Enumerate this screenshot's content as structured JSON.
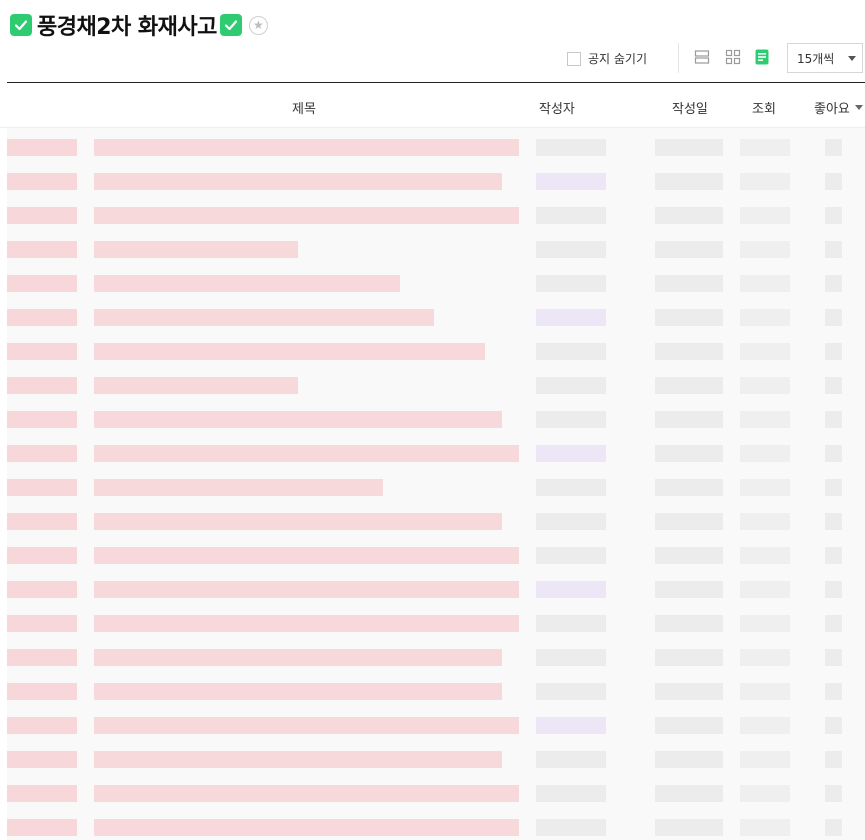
{
  "header": {
    "title": "풍경채2차 화재사고",
    "left_icon": "check-badge-icon",
    "right_icon": "check-badge-icon",
    "favorite_icon": "star-icon"
  },
  "toolbar": {
    "hide_notice_label": "공지 숨기기",
    "hide_notice_checked": false,
    "view_modes": [
      "list-card-icon",
      "album-grid-icon",
      "list-text-icon"
    ],
    "active_view": "list-text-icon",
    "page_size": "15개씩"
  },
  "table": {
    "columns": {
      "title": "제목",
      "author": "작성자",
      "date": "작성일",
      "views": "조회",
      "likes": "좋아요"
    }
  },
  "colors": {
    "brand_green": "#2ecc71",
    "active_view": "#2ecc71",
    "blur_pink": "#f7d3d7",
    "blur_gray": "#ececec",
    "blur_lavender": "#ece6f7"
  }
}
